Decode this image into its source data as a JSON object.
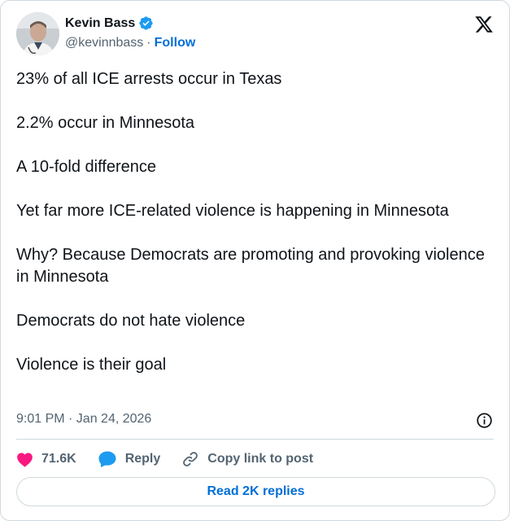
{
  "author": {
    "name": "Kevin Bass",
    "handle": "@kevinnbass",
    "separator": "·",
    "follow_label": "Follow",
    "verified_color": "#1d9bf0"
  },
  "icons": {
    "verified": "verified-badge-icon",
    "brand": "x-logo-icon",
    "info": "info-icon",
    "like": "heart-icon",
    "reply": "speech-bubble-icon",
    "copy": "link-icon"
  },
  "tweet": {
    "paragraphs": [
      "23% of all ICE arrests occur in Texas",
      "2.2% occur in Minnesota",
      "A 10-fold difference",
      "Yet far more ICE-related violence is happening in Minnesota",
      "Why? Because Democrats are promoting and provoking violence in Minnesota",
      "Democrats do not hate violence",
      "Violence is their goal"
    ],
    "timestamp": "9:01 PM · Jan 24, 2026"
  },
  "actions": {
    "like_count": "71.6K",
    "reply_label": "Reply",
    "copy_label": "Copy link to post",
    "like_color": "#f91880",
    "reply_color": "#1d9bf0"
  },
  "footer": {
    "read_replies_label": "Read 2K replies"
  },
  "colors": {
    "link": "#006fd6",
    "secondary_text": "#536471",
    "border": "#cfd9de"
  }
}
